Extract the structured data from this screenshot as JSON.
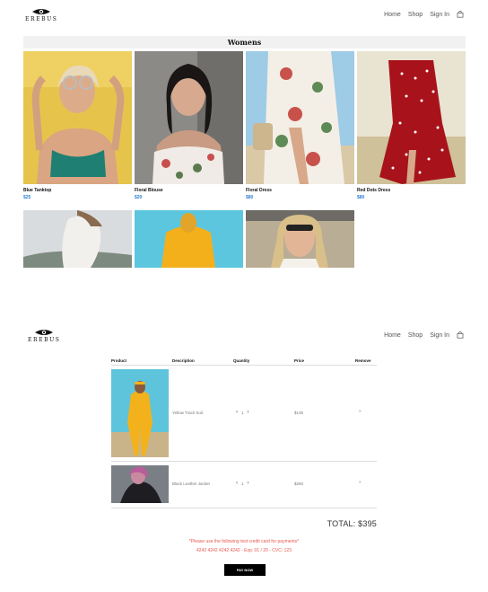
{
  "brand": {
    "name": "EREBUS"
  },
  "nav": {
    "home": "Home",
    "shop": "Shop",
    "signin": "Sign In",
    "cart_icon": "shopping-bag-icon"
  },
  "shop": {
    "title": "Womens",
    "products": [
      {
        "name": "Blue Tanktop",
        "price": "$25"
      },
      {
        "name": "Floral Blouse",
        "price": "$20"
      },
      {
        "name": "Floral Dress",
        "price": "$80"
      },
      {
        "name": "Red Dots Dress",
        "price": "$80"
      }
    ]
  },
  "cart": {
    "headers": {
      "product": "Product",
      "description": "Description",
      "quantity": "Quantity",
      "price": "Price",
      "remove": "Remove"
    },
    "items": [
      {
        "description": "Yellow Track Suit",
        "quantity": "1",
        "price": "$135"
      },
      {
        "description": "Black Leather Jacket",
        "quantity": "1",
        "price": "$260"
      }
    ],
    "total": "TOTAL: $395",
    "note_line1": "*Please use the following test credit card for payments*",
    "note_line2": "4242 4242 4242 4242 - Exp: 01 / 20 - CVC: 123",
    "pay_label": "PAY NOW"
  },
  "colors": {
    "price": "#2e7fd4",
    "note": "#e8594f",
    "button": "#000000"
  }
}
